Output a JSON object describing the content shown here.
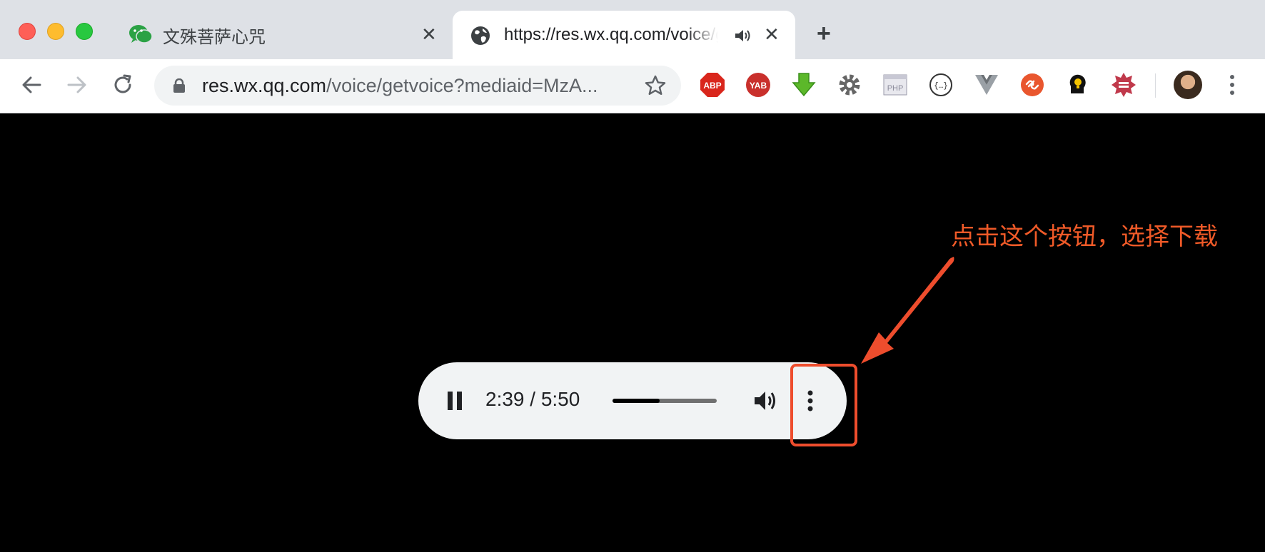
{
  "tabs": [
    {
      "title": "文殊菩萨心咒",
      "icon": "wechat-icon",
      "close": "✕"
    },
    {
      "title": "https://res.wx.qq.com/voice/getvoice?mediaid=MzA",
      "icon": "globe-icon",
      "close": "✕",
      "audio": "speaker-icon"
    }
  ],
  "new_tab": "+",
  "omnibox": {
    "host": "res.wx.qq.com",
    "path": "/voice/getvoice?mediaid=MzA..."
  },
  "extensions": [
    "ABP",
    "YAB",
    "download-arrow-icon",
    "gear-icon",
    "php-icon",
    "json-icon",
    "vue-icon",
    "link-icon",
    "lightbulb-icon",
    "badge-icon"
  ],
  "player": {
    "time": "2:39 / 5:50",
    "progress_fraction": 0.45
  },
  "annotation": {
    "text": "点击这个按钮，选择下载",
    "color": "#f05a28"
  }
}
